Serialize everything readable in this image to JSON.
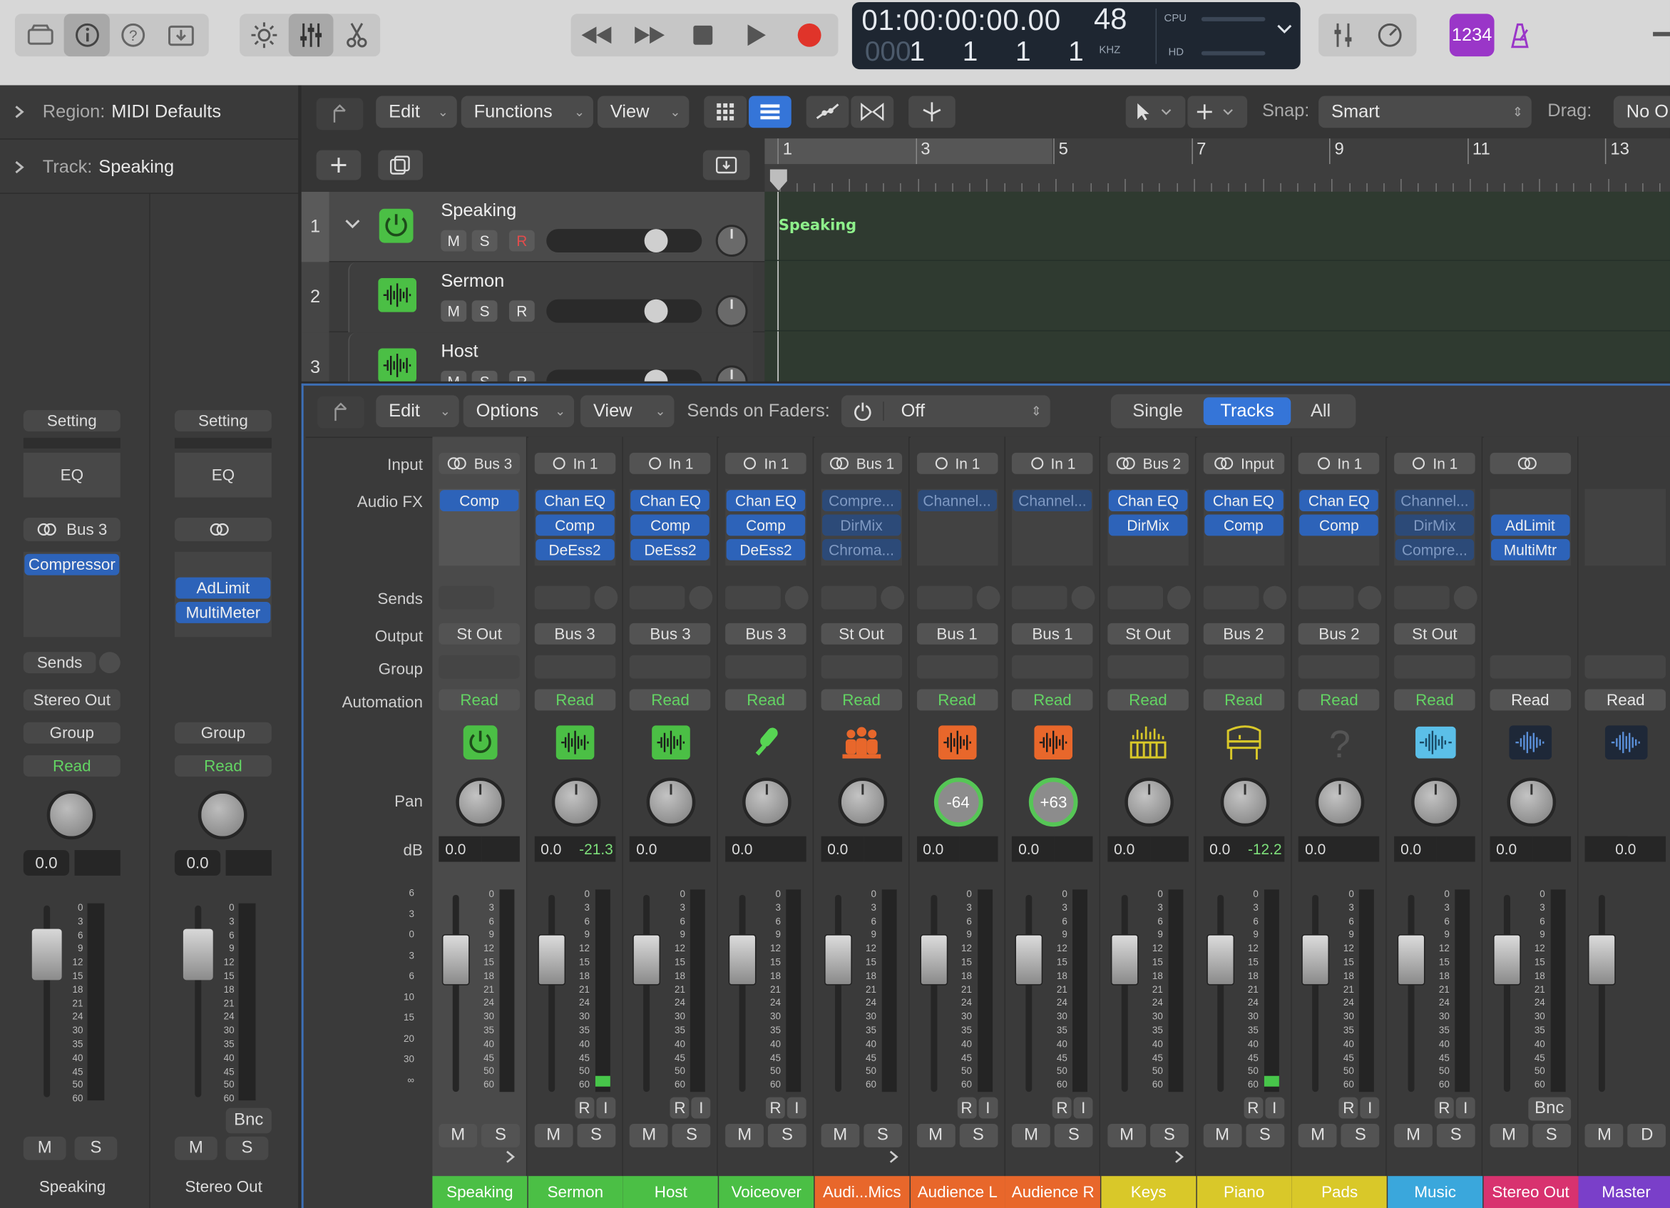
{
  "transport": {
    "timecode": "01:00:00:00.00",
    "bars": "1 1 1 1",
    "bars_dim": "000",
    "sample_rate": "48",
    "sample_rate_unit": "KHZ",
    "cpu_label": "CPU",
    "hd_label": "HD",
    "badge": "1234"
  },
  "inspector": {
    "region_label": "Region:",
    "region_value": "MIDI Defaults",
    "track_label": "Track:",
    "track_value": "Speaking",
    "strips": [
      {
        "setting": "Setting",
        "eq": "EQ",
        "input": "Bus 3",
        "fx": [
          "Compressor"
        ],
        "sends": "Sends",
        "output": "Stereo Out",
        "group": "Group",
        "automation": "Read",
        "db": "0.0",
        "name": "Speaking",
        "mute": "M",
        "solo": "S"
      },
      {
        "setting": "Setting",
        "eq": "EQ",
        "input": "",
        "fx": [
          "AdLimit",
          "MultiMeter"
        ],
        "output": "",
        "group": "Group",
        "automation": "Read",
        "db": "0.0",
        "name": "Stereo Out",
        "mute": "M",
        "solo": "S",
        "bnc": "Bnc"
      }
    ]
  },
  "tracks_toolbar": {
    "edit": "Edit",
    "functions": "Functions",
    "view": "View",
    "snap_label": "Snap:",
    "snap_value": "Smart",
    "drag_label": "Drag:",
    "drag_value": "No O"
  },
  "ruler": [
    "1",
    "3",
    "5",
    "7",
    "9",
    "11",
    "13"
  ],
  "tracks": [
    {
      "number": "1",
      "name": "Speaking",
      "mute": "M",
      "solo": "S",
      "rec": "R"
    },
    {
      "number": "2",
      "name": "Sermon",
      "mute": "M",
      "solo": "S",
      "rec": "R"
    },
    {
      "number": "3",
      "name": "Host",
      "mute": "M",
      "solo": "S",
      "rec": "R"
    }
  ],
  "region_name": "Speaking",
  "mixer_toolbar": {
    "edit": "Edit",
    "options": "Options",
    "view": "View",
    "sends_label": "Sends on Faders:",
    "sends_value": "Off",
    "single": "Single",
    "tracks": "Tracks",
    "all": "All"
  },
  "row_labels": {
    "input": "Input",
    "audio_fx": "Audio FX",
    "sends": "Sends",
    "output": "Output",
    "group": "Group",
    "automation": "Automation",
    "pan": "Pan",
    "db": "dB"
  },
  "fader_scale_left": [
    "6",
    "3",
    "0",
    "3",
    "6",
    "10",
    "15",
    "20",
    "30",
    "∞"
  ],
  "fader_scale_strip": [
    "0",
    "3",
    "6",
    "9",
    "12",
    "15",
    "18",
    "21",
    "24",
    "30",
    "35",
    "40",
    "45",
    "50",
    "60"
  ],
  "channels": [
    {
      "name": "Speaking",
      "input": "Bus 3",
      "fx": [
        "Comp"
      ],
      "output": "St Out",
      "automation": "Read",
      "pan": "",
      "db": "0.0",
      "peak": "",
      "icon": "power-icon",
      "color": "#4bbf45",
      "ri": false,
      "fader": 0.2
    },
    {
      "name": "Sermon",
      "input": "In 1",
      "fx": [
        "Chan EQ",
        "Comp",
        "DeEss2"
      ],
      "output": "Bus 3",
      "automation": "Read",
      "pan": "",
      "db": "0.0",
      "peak": "-21.3",
      "icon": "waveform-icon",
      "color": "#4bbf45",
      "ri": true,
      "fader": 0.2
    },
    {
      "name": "Host",
      "input": "In 1",
      "fx": [
        "Chan EQ",
        "Comp",
        "DeEss2"
      ],
      "output": "Bus 3",
      "automation": "Read",
      "pan": "",
      "db": "0.0",
      "peak": "",
      "icon": "waveform-icon",
      "color": "#4bbf45",
      "ri": true,
      "fader": 0.2
    },
    {
      "name": "Voiceover",
      "input": "In 1",
      "fx": [
        "Chan EQ",
        "Comp",
        "DeEss2"
      ],
      "output": "Bus 3",
      "automation": "Read",
      "pan": "",
      "db": "0.0",
      "peak": "",
      "icon": "microphone-icon",
      "color": "#4bbf45",
      "ri": true,
      "fader": 0.2
    },
    {
      "name": "Audi...Mics",
      "input": "Bus 1",
      "fx": [
        "Compre...",
        "DirMix",
        "Chroma..."
      ],
      "fxdim": true,
      "output": "St Out",
      "automation": "Read",
      "pan": "",
      "db": "0.0",
      "peak": "",
      "icon": "audience-icon",
      "color": "#e8672b",
      "ri": false,
      "fader": 0.2
    },
    {
      "name": "Audience L",
      "input": "In 1",
      "fx": [
        "Channel..."
      ],
      "fxdim": true,
      "output": "Bus 1",
      "automation": "Read",
      "pan": "-64",
      "db": "0.0",
      "peak": "",
      "icon": "waveform-icon",
      "color": "#e8672b",
      "ri": true,
      "fader": 0.2
    },
    {
      "name": "Audience R",
      "input": "In 1",
      "fx": [
        "Channel..."
      ],
      "fxdim": true,
      "output": "Bus 1",
      "automation": "Read",
      "pan": "+63",
      "db": "0.0",
      "peak": "",
      "icon": "waveform-icon",
      "color": "#e8672b",
      "ri": true,
      "fader": 0.2
    },
    {
      "name": "Keys",
      "input": "Bus 2",
      "fx": [
        "Chan EQ",
        "DirMix"
      ],
      "output": "St Out",
      "automation": "Read",
      "pan": "",
      "db": "0.0",
      "peak": "",
      "icon": "keyboard-icon",
      "color": "#d9c829",
      "ri": false,
      "fader": 0.2
    },
    {
      "name": "Piano",
      "input": "Input",
      "fx": [
        "Chan EQ",
        "Comp"
      ],
      "output": "Bus 2",
      "automation": "Read",
      "pan": "",
      "db": "0.0",
      "peak": "-12.2",
      "icon": "piano-icon",
      "color": "#d9c829",
      "ri": true,
      "fader": 0.2
    },
    {
      "name": "Pads",
      "input": "In 1",
      "fx": [
        "Chan EQ",
        "Comp"
      ],
      "output": "Bus 2",
      "automation": "Read",
      "pan": "",
      "db": "0.0",
      "peak": "",
      "icon": "question-icon",
      "color": "#d9c829",
      "ri": true,
      "fader": 0.2
    },
    {
      "name": "Music",
      "input": "In 1",
      "fx": [
        "Channel...",
        "DirMix",
        "Compre..."
      ],
      "fxdim": true,
      "output": "St Out",
      "automation": "Read",
      "pan": "",
      "db": "0.0",
      "peak": "",
      "icon": "wave-icon",
      "color": "#3aa7dc",
      "ri": true,
      "fader": 0.2
    },
    {
      "name": "Stereo Out",
      "input": "",
      "fx": [
        "",
        "AdLimit",
        "MultiMtr"
      ],
      "output": "",
      "automation": "Read",
      "pan": "",
      "db": "0.0",
      "peak": "",
      "icon": "output-icon",
      "color": "#d8326f",
      "ri": false,
      "bnc": "Bnc",
      "fader": 0.2
    },
    {
      "name": "Master",
      "input": "",
      "fx": [],
      "output": "",
      "automation": "Read",
      "pan": "",
      "db": "0.0",
      "peak": "",
      "icon": "output-icon",
      "color": "#7a3fc9",
      "ri": false,
      "master": true,
      "fader": 0.2
    }
  ],
  "ri_labels": {
    "r": "R",
    "i": "I"
  },
  "ms_labels": {
    "m": "M",
    "s": "S",
    "d": "D"
  }
}
